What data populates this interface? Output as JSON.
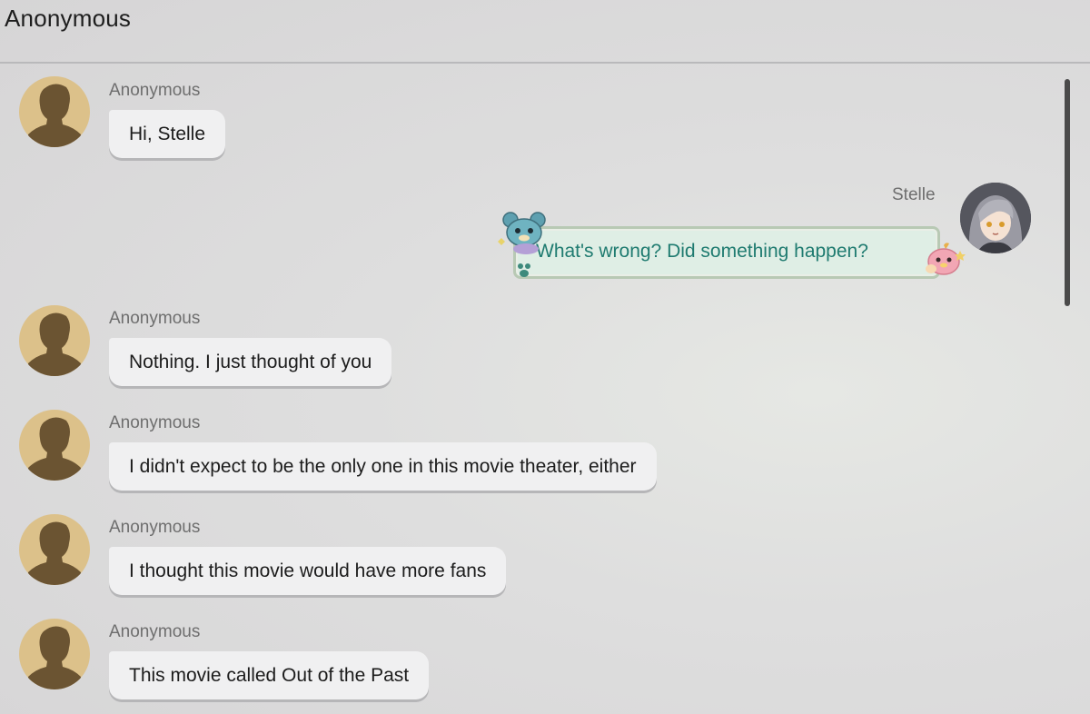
{
  "header": {
    "title": "Anonymous"
  },
  "messages": [
    {
      "sender": "Anonymous",
      "text": "Hi, Stelle"
    },
    {
      "sender": "Stelle",
      "text": "What's wrong? Did something happen?"
    },
    {
      "sender": "Anonymous",
      "text": "Nothing. I just thought of you"
    },
    {
      "sender": "Anonymous",
      "text": "I didn't expect to be the only one in this movie theater, either"
    },
    {
      "sender": "Anonymous",
      "text": "I thought this movie would have more fans"
    },
    {
      "sender": "Anonymous",
      "text": "This movie called Out of the Past"
    }
  ],
  "colors": {
    "anon_avatar_bg": "#dcc18a",
    "anon_silhouette": "#6b5432",
    "stelle_text": "#1f7b70",
    "stelle_bubble_bg": "#dfeee5",
    "bubble_bg": "#f0f0f1"
  }
}
